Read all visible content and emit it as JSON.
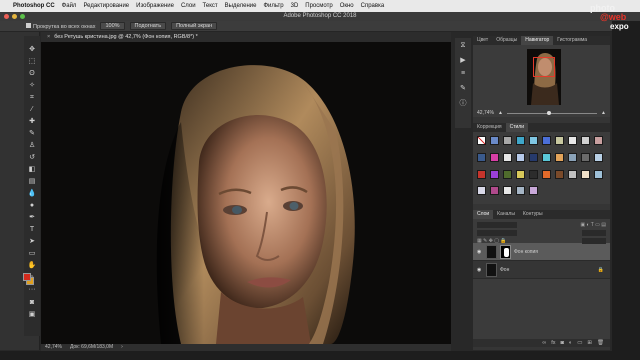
{
  "menubar": {
    "app": "Photoshop CC",
    "items": [
      "Файл",
      "Редактирование",
      "Изображение",
      "Слои",
      "Текст",
      "Выделение",
      "Фильтр",
      "3D",
      "Просмотр",
      "Окно",
      "Справка"
    ]
  },
  "window": {
    "title": "Adobe Photoshop CC 2018"
  },
  "options": {
    "scroll_all": "Прокрутка во всех окнах",
    "zoom_100": "100%",
    "fit": "Подогнать",
    "fullscreen": "Полный экран"
  },
  "document": {
    "tab": "без Ретушь кристина.jpg @ 42,7% (Фон копия, RGB/8*) *",
    "zoom": "42,74%",
    "doc_size": "Док: 69,6M/183,0M"
  },
  "panels": {
    "top_tabs": [
      "Цвет",
      "Образцы",
      "Навигатор",
      "Гистограмма"
    ],
    "active_top": "Навигатор",
    "nav_zoom": "42,74%",
    "style_tabs": [
      "Коррекция",
      "Стили"
    ],
    "active_style": "Стили",
    "layer_tabs": [
      "Слои",
      "Каналы",
      "Контуры"
    ],
    "active_layer_tab": "Слои",
    "layers": [
      {
        "name": "Фон копия",
        "selected": true
      },
      {
        "name": "Фон",
        "selected": false
      }
    ]
  },
  "watermark": {
    "line1": "photo",
    "line2": "@web",
    "line3": "expo"
  },
  "colors": {
    "accent_red": "#e53a2a",
    "foreground": "#d22a1c",
    "background": "#e0a020"
  },
  "icons": [
    "move-icon",
    "marquee-icon",
    "lasso-icon",
    "magic-wand-icon",
    "crop-icon",
    "eyedropper-icon",
    "healing-icon",
    "brush-icon",
    "clone-stamp-icon",
    "history-brush-icon",
    "eraser-icon",
    "gradient-icon",
    "blur-icon",
    "dodge-icon",
    "pen-icon",
    "type-icon",
    "path-select-icon",
    "shape-icon",
    "hand-icon",
    "zoom-icon"
  ]
}
